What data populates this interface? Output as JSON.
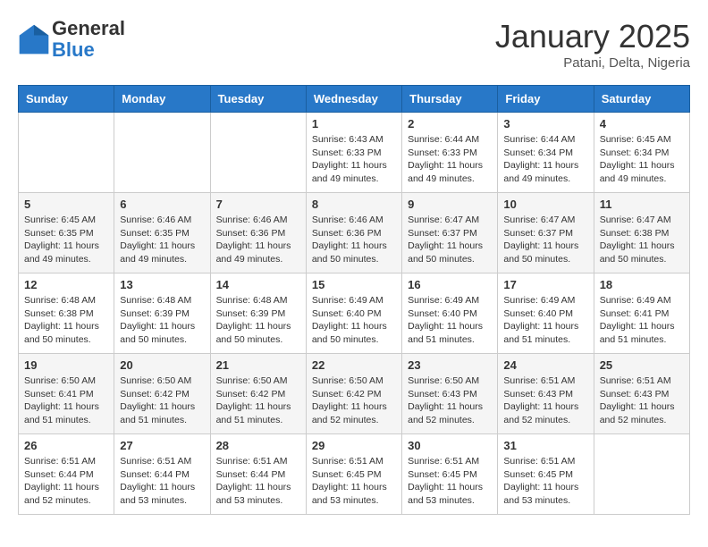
{
  "header": {
    "logo_general": "General",
    "logo_blue": "Blue",
    "month_title": "January 2025",
    "subtitle": "Patani, Delta, Nigeria"
  },
  "weekdays": [
    "Sunday",
    "Monday",
    "Tuesday",
    "Wednesday",
    "Thursday",
    "Friday",
    "Saturday"
  ],
  "weeks": [
    [
      {
        "day": "",
        "sunrise": "",
        "sunset": "",
        "daylight": ""
      },
      {
        "day": "",
        "sunrise": "",
        "sunset": "",
        "daylight": ""
      },
      {
        "day": "",
        "sunrise": "",
        "sunset": "",
        "daylight": ""
      },
      {
        "day": "1",
        "sunrise": "Sunrise: 6:43 AM",
        "sunset": "Sunset: 6:33 PM",
        "daylight": "Daylight: 11 hours and 49 minutes."
      },
      {
        "day": "2",
        "sunrise": "Sunrise: 6:44 AM",
        "sunset": "Sunset: 6:33 PM",
        "daylight": "Daylight: 11 hours and 49 minutes."
      },
      {
        "day": "3",
        "sunrise": "Sunrise: 6:44 AM",
        "sunset": "Sunset: 6:34 PM",
        "daylight": "Daylight: 11 hours and 49 minutes."
      },
      {
        "day": "4",
        "sunrise": "Sunrise: 6:45 AM",
        "sunset": "Sunset: 6:34 PM",
        "daylight": "Daylight: 11 hours and 49 minutes."
      }
    ],
    [
      {
        "day": "5",
        "sunrise": "Sunrise: 6:45 AM",
        "sunset": "Sunset: 6:35 PM",
        "daylight": "Daylight: 11 hours and 49 minutes."
      },
      {
        "day": "6",
        "sunrise": "Sunrise: 6:46 AM",
        "sunset": "Sunset: 6:35 PM",
        "daylight": "Daylight: 11 hours and 49 minutes."
      },
      {
        "day": "7",
        "sunrise": "Sunrise: 6:46 AM",
        "sunset": "Sunset: 6:36 PM",
        "daylight": "Daylight: 11 hours and 49 minutes."
      },
      {
        "day": "8",
        "sunrise": "Sunrise: 6:46 AM",
        "sunset": "Sunset: 6:36 PM",
        "daylight": "Daylight: 11 hours and 50 minutes."
      },
      {
        "day": "9",
        "sunrise": "Sunrise: 6:47 AM",
        "sunset": "Sunset: 6:37 PM",
        "daylight": "Daylight: 11 hours and 50 minutes."
      },
      {
        "day": "10",
        "sunrise": "Sunrise: 6:47 AM",
        "sunset": "Sunset: 6:37 PM",
        "daylight": "Daylight: 11 hours and 50 minutes."
      },
      {
        "day": "11",
        "sunrise": "Sunrise: 6:47 AM",
        "sunset": "Sunset: 6:38 PM",
        "daylight": "Daylight: 11 hours and 50 minutes."
      }
    ],
    [
      {
        "day": "12",
        "sunrise": "Sunrise: 6:48 AM",
        "sunset": "Sunset: 6:38 PM",
        "daylight": "Daylight: 11 hours and 50 minutes."
      },
      {
        "day": "13",
        "sunrise": "Sunrise: 6:48 AM",
        "sunset": "Sunset: 6:39 PM",
        "daylight": "Daylight: 11 hours and 50 minutes."
      },
      {
        "day": "14",
        "sunrise": "Sunrise: 6:48 AM",
        "sunset": "Sunset: 6:39 PM",
        "daylight": "Daylight: 11 hours and 50 minutes."
      },
      {
        "day": "15",
        "sunrise": "Sunrise: 6:49 AM",
        "sunset": "Sunset: 6:40 PM",
        "daylight": "Daylight: 11 hours and 50 minutes."
      },
      {
        "day": "16",
        "sunrise": "Sunrise: 6:49 AM",
        "sunset": "Sunset: 6:40 PM",
        "daylight": "Daylight: 11 hours and 51 minutes."
      },
      {
        "day": "17",
        "sunrise": "Sunrise: 6:49 AM",
        "sunset": "Sunset: 6:40 PM",
        "daylight": "Daylight: 11 hours and 51 minutes."
      },
      {
        "day": "18",
        "sunrise": "Sunrise: 6:49 AM",
        "sunset": "Sunset: 6:41 PM",
        "daylight": "Daylight: 11 hours and 51 minutes."
      }
    ],
    [
      {
        "day": "19",
        "sunrise": "Sunrise: 6:50 AM",
        "sunset": "Sunset: 6:41 PM",
        "daylight": "Daylight: 11 hours and 51 minutes."
      },
      {
        "day": "20",
        "sunrise": "Sunrise: 6:50 AM",
        "sunset": "Sunset: 6:42 PM",
        "daylight": "Daylight: 11 hours and 51 minutes."
      },
      {
        "day": "21",
        "sunrise": "Sunrise: 6:50 AM",
        "sunset": "Sunset: 6:42 PM",
        "daylight": "Daylight: 11 hours and 51 minutes."
      },
      {
        "day": "22",
        "sunrise": "Sunrise: 6:50 AM",
        "sunset": "Sunset: 6:42 PM",
        "daylight": "Daylight: 11 hours and 52 minutes."
      },
      {
        "day": "23",
        "sunrise": "Sunrise: 6:50 AM",
        "sunset": "Sunset: 6:43 PM",
        "daylight": "Daylight: 11 hours and 52 minutes."
      },
      {
        "day": "24",
        "sunrise": "Sunrise: 6:51 AM",
        "sunset": "Sunset: 6:43 PM",
        "daylight": "Daylight: 11 hours and 52 minutes."
      },
      {
        "day": "25",
        "sunrise": "Sunrise: 6:51 AM",
        "sunset": "Sunset: 6:43 PM",
        "daylight": "Daylight: 11 hours and 52 minutes."
      }
    ],
    [
      {
        "day": "26",
        "sunrise": "Sunrise: 6:51 AM",
        "sunset": "Sunset: 6:44 PM",
        "daylight": "Daylight: 11 hours and 52 minutes."
      },
      {
        "day": "27",
        "sunrise": "Sunrise: 6:51 AM",
        "sunset": "Sunset: 6:44 PM",
        "daylight": "Daylight: 11 hours and 53 minutes."
      },
      {
        "day": "28",
        "sunrise": "Sunrise: 6:51 AM",
        "sunset": "Sunset: 6:44 PM",
        "daylight": "Daylight: 11 hours and 53 minutes."
      },
      {
        "day": "29",
        "sunrise": "Sunrise: 6:51 AM",
        "sunset": "Sunset: 6:45 PM",
        "daylight": "Daylight: 11 hours and 53 minutes."
      },
      {
        "day": "30",
        "sunrise": "Sunrise: 6:51 AM",
        "sunset": "Sunset: 6:45 PM",
        "daylight": "Daylight: 11 hours and 53 minutes."
      },
      {
        "day": "31",
        "sunrise": "Sunrise: 6:51 AM",
        "sunset": "Sunset: 6:45 PM",
        "daylight": "Daylight: 11 hours and 53 minutes."
      },
      {
        "day": "",
        "sunrise": "",
        "sunset": "",
        "daylight": ""
      }
    ]
  ]
}
